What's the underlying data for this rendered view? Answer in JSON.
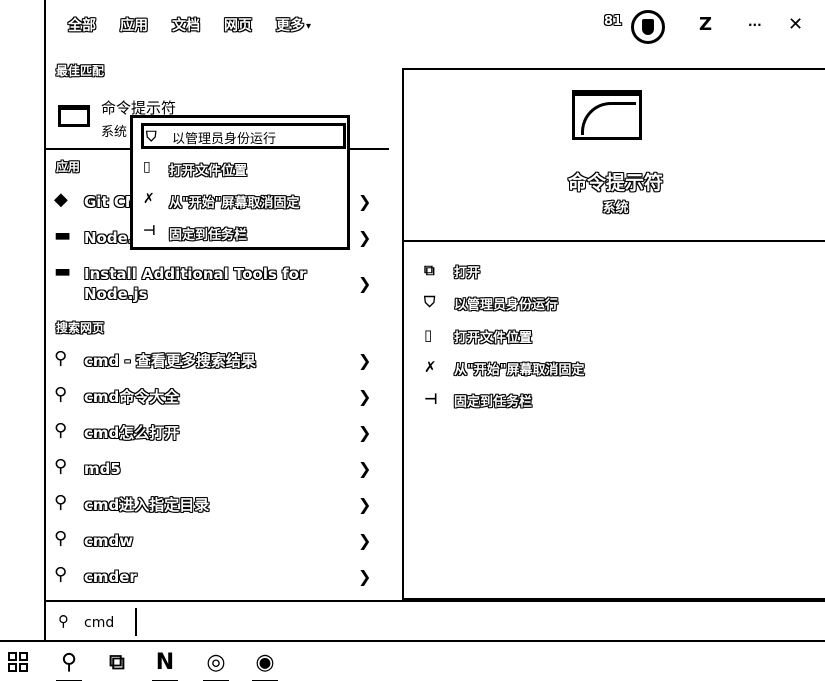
{
  "topbar": {
    "tabs": [
      "全部",
      "应用",
      "文档",
      "网页",
      "更多"
    ],
    "more_chevron": "▾",
    "points": "81",
    "controls": {
      "feedback": "Z",
      "options": "···",
      "close": "✕"
    }
  },
  "best_match": {
    "section_label": "最佳匹配",
    "name": "命令提示符",
    "subtitle": "系统"
  },
  "apps": {
    "section_label": "应用",
    "items": [
      {
        "label": "Git CMD",
        "icon": "git-icon"
      },
      {
        "label": "Node.js",
        "icon": "node-icon"
      },
      {
        "label": "Install Additional Tools for\nNode.js",
        "icon": "node-icon"
      }
    ]
  },
  "web": {
    "section_label": "搜索网页",
    "items": [
      {
        "label": "cmd - 查看更多搜索结果"
      },
      {
        "label": "cmd命令大全"
      },
      {
        "label": "cmd怎么打开"
      },
      {
        "label": "md5"
      },
      {
        "label": "cmd进入指定目录"
      },
      {
        "label": "cmdw"
      },
      {
        "label": "cmder"
      }
    ]
  },
  "context_menu": {
    "items": [
      {
        "label": "以管理员身份运行",
        "icon": "shield-icon",
        "selected": true
      },
      {
        "label": "打开文件位置",
        "icon": "folder-icon",
        "selected": false
      },
      {
        "label": "从\"开始\"屏幕取消固定",
        "icon": "unpin-icon",
        "selected": false
      },
      {
        "label": "固定到任务栏",
        "icon": "pin-icon",
        "selected": false
      }
    ]
  },
  "preview": {
    "name": "命令提示符",
    "subtitle": "系统",
    "actions": [
      {
        "label": "打开",
        "icon": "open-icon"
      },
      {
        "label": "以管理员身份运行",
        "icon": "shield-icon"
      },
      {
        "label": "打开文件位置",
        "icon": "folder-icon"
      },
      {
        "label": "从\"开始\"屏幕取消固定",
        "icon": "unpin-icon"
      },
      {
        "label": "固定到任务栏",
        "icon": "pin-icon"
      }
    ]
  },
  "search": {
    "value": "cmd"
  },
  "taskbar": {
    "icons": [
      "start-icon",
      "search-icon",
      "task-view-icon",
      "onenote-icon",
      "chrome-icon",
      "chrome-canary-icon"
    ]
  }
}
